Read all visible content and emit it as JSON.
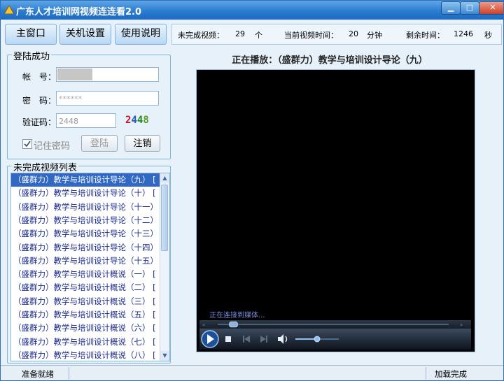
{
  "title_bar": {
    "title": "广东人才培训网视频连连看2.0",
    "minimize_label": "▁",
    "maximize_label": "□",
    "close_label": "✕"
  },
  "toolbar": {
    "main_window": "主窗口",
    "shutdown_settings": "关机设置",
    "help": "使用说明"
  },
  "info": {
    "incomplete_label": "未完成视频：",
    "incomplete_value": "29",
    "incomplete_unit": "个",
    "current_time_label": "当前视频时间：",
    "current_time_value": "20",
    "current_time_unit": "分钟",
    "remaining_label": "剩余时间：",
    "remaining_value": "1246",
    "remaining_unit": "秒"
  },
  "login": {
    "group_title": "登陆成功",
    "account_label": "帐　号：",
    "account_value": "",
    "password_label": "密　码：",
    "password_value": "******",
    "captcha_label": "验证码：",
    "captcha_value": "2448",
    "captcha_digits": [
      "2",
      "4",
      "4",
      "8"
    ],
    "captcha_colors": [
      "#c8102e",
      "#1a5bb5",
      "#1a8c1a",
      "#5a9a2a"
    ],
    "remember_label": "记住密码",
    "remember_checked": true,
    "login_button": "登陆",
    "logout_button": "注销"
  },
  "video_list": {
    "title": "未完成视频列表",
    "items": [
      "（盛群力）教学与培训设计导论（九）  [",
      "（盛群力）教学与培训设计导论（十）  [",
      "（盛群力）教学与培训设计导论（十一）",
      "（盛群力）教学与培训设计导论（十二）",
      "（盛群力）教学与培训设计导论（十三）",
      "（盛群力）教学与培训设计导论（十四）",
      "（盛群力）教学与培训设计导论（十五）",
      "（盛群力）教学与培训设计概说（一）  [",
      "（盛群力）教学与培训设计概说（二）  [",
      "（盛群力）教学与培训设计概说（三）  [",
      "（盛群力）教学与培训设计概说（五）  [",
      "（盛群力）教学与培训设计概说（六）  [",
      "（盛群力）教学与培训设计概说（七）  [",
      "（盛群力）教学与培训设计概说（八）  ["
    ],
    "selected_index": 0
  },
  "player": {
    "now_playing": "正在播放：（盛群力）教学与培训设计导论（九）",
    "status": "正在连接到媒体...",
    "progress_fraction": 0.05,
    "volume_fraction": 0.5
  },
  "statusbar": {
    "left": "准备就绪",
    "right": "加载完成"
  }
}
